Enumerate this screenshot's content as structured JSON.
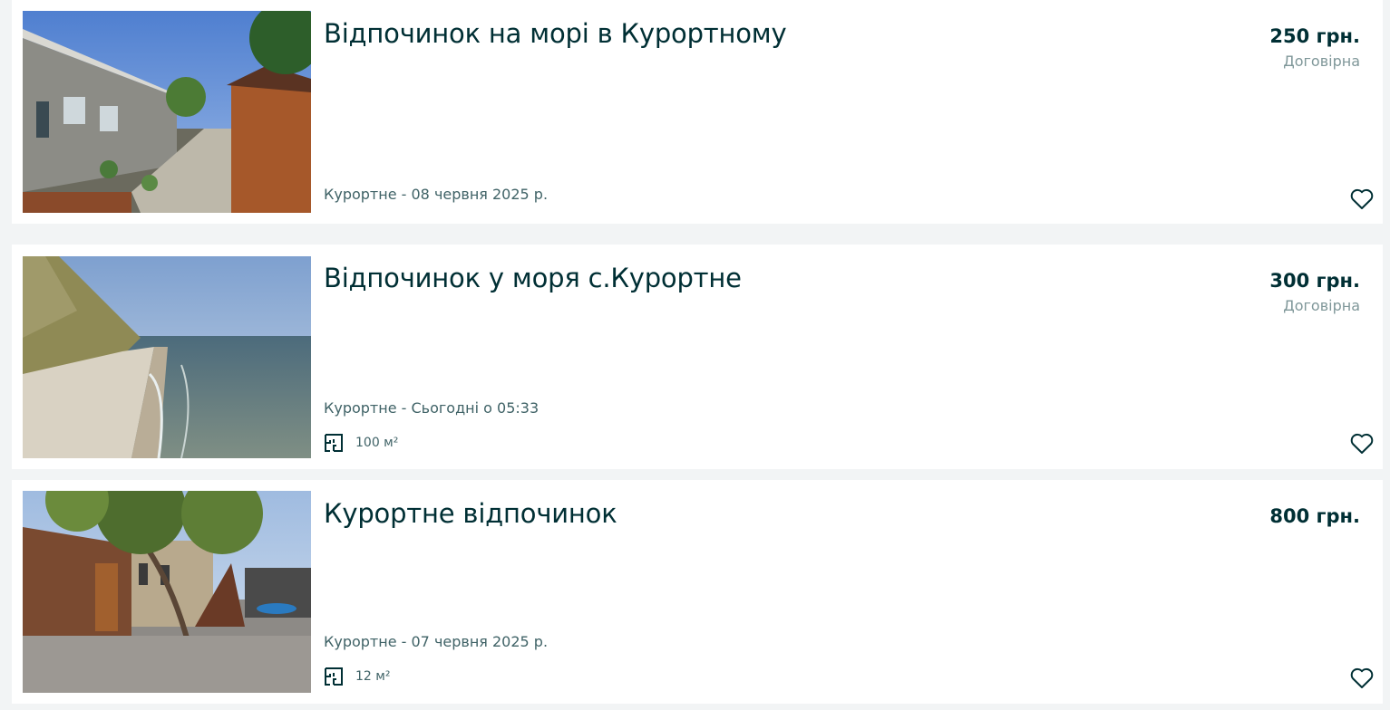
{
  "listings": [
    {
      "title": "Відпочинок на морі в Курортному",
      "price": "250 грн.",
      "negotiable": "Договірна",
      "location_date": "Курортне - 08 червня 2025 р.",
      "area": null,
      "photo": "guesthouse-bungalows-photo",
      "favorite_icon": "heart-icon"
    },
    {
      "title": "Відпочинок у моря с.Курортне",
      "price": "300 грн.",
      "negotiable": "Договірна",
      "location_date": "Курортне - Сьогодні о 05:33",
      "area": "100 м²",
      "area_icon": "floor-plan-icon",
      "photo": "sea-beach-photo",
      "favorite_icon": "heart-icon"
    },
    {
      "title": "Курортне відпочинок",
      "price": "800 грн.",
      "negotiable": null,
      "location_date": "Курортне - 07 червня 2025 р.",
      "area": "12 м²",
      "area_icon": "floor-plan-icon",
      "photo": "courtyard-cottage-photo",
      "favorite_icon": "heart-icon"
    }
  ],
  "colors": {
    "page_background": "#f2f4f5",
    "card_background": "#ffffff",
    "title_text": "#002f34",
    "meta_text": "#406367",
    "muted_text": "#7f9799"
  }
}
